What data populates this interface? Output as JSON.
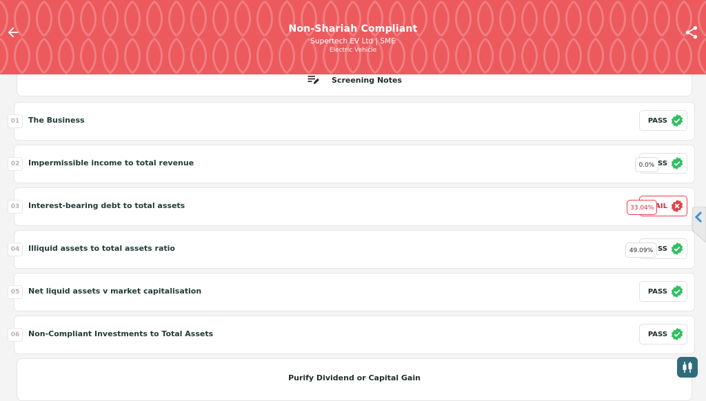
{
  "header": {
    "title": "Non-Shariah Compliant",
    "company": "Supertech EV Ltd | SME",
    "sector": "Electric Vehicle",
    "color": "#ec5a5e"
  },
  "notes": {
    "label": "Screening Notes",
    "icon": "notes-edit-icon"
  },
  "rows": [
    {
      "num": "01",
      "label": "The Business",
      "status": "PASS",
      "value": ""
    },
    {
      "num": "02",
      "label": "Impermissible income to total revenue",
      "status": "SS",
      "value": "0.0%"
    },
    {
      "num": "03",
      "label": "Interest-bearing debt to total assets",
      "status": "AIL",
      "value": "33.04%"
    },
    {
      "num": "04",
      "label": "Illiquid assets to total assets ratio",
      "status": "SS",
      "value": "49.09%"
    },
    {
      "num": "05",
      "label": "Net liquid assets v market capitalisation",
      "status": "PASS",
      "value": ""
    },
    {
      "num": "06",
      "label": "Non-Compliant Investments to Total Assets",
      "status": "PASS",
      "value": ""
    }
  ],
  "purify": {
    "label": "Purify Dividend or Capital Gain"
  },
  "colors": {
    "pass": "#2ec05f",
    "fail": "#e53e46",
    "fab": "#2f6b7c",
    "sidetab": "#3f8fd8"
  },
  "icons": {
    "back": "arrow-left-icon",
    "share": "share-icon",
    "pass": "check-badge-icon",
    "fail": "x-badge-icon",
    "sidetab": "chevron-left-icon",
    "fab": "candlestick-icon"
  }
}
